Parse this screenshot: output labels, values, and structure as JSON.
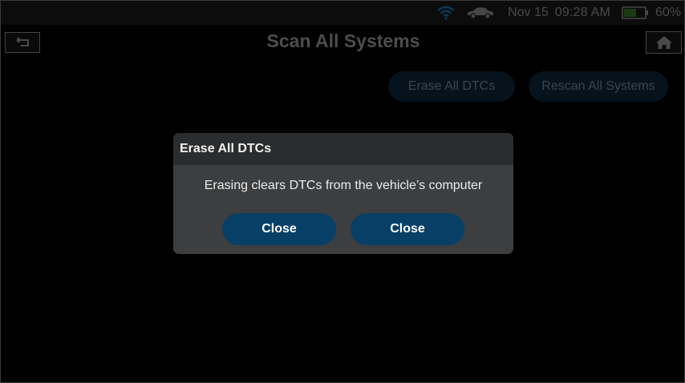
{
  "status_bar": {
    "date": "Nov 15",
    "time": "09:28 AM",
    "battery_percent": "60%",
    "battery_level": 0.6,
    "icons": [
      "wifi-icon",
      "car-icon",
      "battery-icon"
    ]
  },
  "header": {
    "title": "Scan All Systems",
    "back_icon": "back-arrow-icon",
    "home_icon": "home-icon"
  },
  "actions": {
    "erase_label": "Erase All DTCs",
    "rescan_label": "Rescan All Systems"
  },
  "dialog": {
    "title": "Erase All DTCs",
    "message": "Erasing clears DTCs from the vehicle’s computer",
    "button_1": "Close",
    "button_2": "Close"
  },
  "colors": {
    "dialog_bg": "#3c3e40",
    "dialog_header_bg": "#2a2c2e",
    "button_bg": "#083f66",
    "dim_text": "#4c4c4c"
  }
}
